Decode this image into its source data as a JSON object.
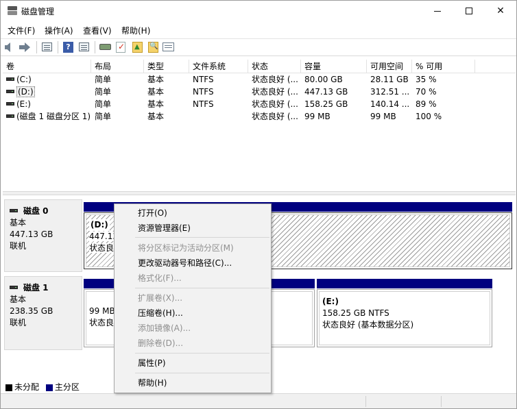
{
  "window": {
    "title": "磁盘管理",
    "min_glyph": "—",
    "close_glyph": "✕"
  },
  "menu": {
    "file": "文件(F)",
    "action": "操作(A)",
    "view": "查看(V)",
    "help": "帮助(H)"
  },
  "toolbar": {
    "icons": [
      "back-arrow-icon",
      "forward-arrow-icon",
      "console-tree-icon",
      "help-icon",
      "list-view-icon",
      "disk-icon",
      "checklist-icon",
      "folder-up-icon",
      "folder-search-icon",
      "properties-icon"
    ]
  },
  "volume_table": {
    "columns": [
      "卷",
      "布局",
      "类型",
      "文件系统",
      "状态",
      "容量",
      "可用空间",
      "% 可用"
    ],
    "rows": [
      {
        "name": "(C:)",
        "layout": "简单",
        "type": "基本",
        "fs": "NTFS",
        "status": "状态良好 (...",
        "capacity": "80.00 GB",
        "free": "28.11 GB",
        "pct": "35 %"
      },
      {
        "name": "(D:)",
        "layout": "简单",
        "type": "基本",
        "fs": "NTFS",
        "status": "状态良好 (...",
        "capacity": "447.13 GB",
        "free": "312.51 ...",
        "pct": "70 %"
      },
      {
        "name": "(E:)",
        "layout": "简单",
        "type": "基本",
        "fs": "NTFS",
        "status": "状态良好 (...",
        "capacity": "158.25 GB",
        "free": "140.14 ...",
        "pct": "89 %"
      },
      {
        "name": "(磁盘 1 磁盘分区 1)",
        "layout": "简单",
        "type": "基本",
        "fs": "",
        "status": "状态良好 (...",
        "capacity": "99 MB",
        "free": "99 MB",
        "pct": "100 %"
      }
    ]
  },
  "disks": [
    {
      "name": "磁盘 0",
      "type": "基本",
      "size": "447.13 GB",
      "state": "联机",
      "partitions": [
        {
          "label": "(D:)",
          "size": "447.13",
          "status": "状态良"
        }
      ]
    },
    {
      "name": "磁盘 1",
      "type": "基本",
      "size": "238.35 GB",
      "state": "联机",
      "partitions": [
        {
          "label": "",
          "size": "99 MB",
          "status": "状态良"
        },
        {
          "label": "(E:)",
          "size": "158.25 GB NTFS",
          "status": "状态良好 (基本数据分区)"
        }
      ]
    }
  ],
  "legend": {
    "unallocated": "未分配",
    "primary": "主分区",
    "unallocated_color": "#000000",
    "primary_color": "#00007f"
  },
  "context_menu": {
    "items": [
      {
        "label": "打开(O)",
        "enabled": true
      },
      {
        "label": "资源管理器(E)",
        "enabled": true
      },
      {
        "label": "将分区标记为活动分区(M)",
        "enabled": false
      },
      {
        "label": "更改驱动器号和路径(C)...",
        "enabled": true
      },
      {
        "label": "格式化(F)...",
        "enabled": false
      },
      {
        "label": "扩展卷(X)...",
        "enabled": false
      },
      {
        "label": "压缩卷(H)...",
        "enabled": true
      },
      {
        "label": "添加镜像(A)...",
        "enabled": false
      },
      {
        "label": "删除卷(D)...",
        "enabled": false
      },
      {
        "label": "属性(P)",
        "enabled": true
      },
      {
        "label": "帮助(H)",
        "enabled": true
      }
    ]
  }
}
